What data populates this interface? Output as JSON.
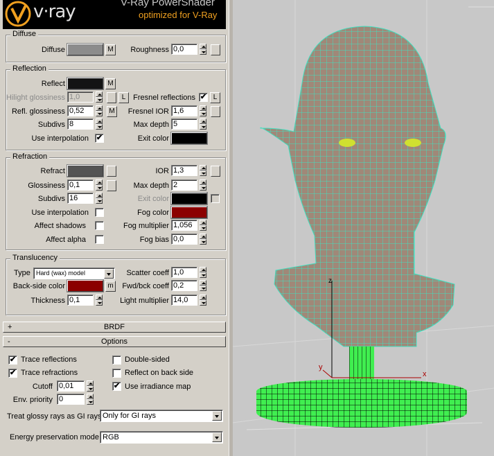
{
  "banner": {
    "logo": "v·ray",
    "title": "V-Ray PowerShader",
    "subtitle": "optimized for V-Ray"
  },
  "diffuse": {
    "group": "Diffuse",
    "diffuse_label": "Diffuse",
    "m": "M",
    "roughness_label": "Roughness",
    "roughness": "0,0",
    "color": "#8c8c8c"
  },
  "reflection": {
    "group": "Reflection",
    "reflect_label": "Reflect",
    "m": "M",
    "reflect_color": "#141414",
    "hilight_label": "Hilight glossiness",
    "hilight": "1,0",
    "l": "L",
    "fresnel_label": "Fresnel reflections",
    "fresnel_checked": "✔",
    "refl_gloss_label": "Refl. glossiness",
    "refl_gloss": "0,52",
    "fresnel_ior_label": "Fresnel IOR",
    "fresnel_ior": "1,6",
    "subdivs_label": "Subdivs",
    "subdivs": "8",
    "maxdepth_label": "Max depth",
    "maxdepth": "5",
    "interp_label": "Use interpolation",
    "interp_checked": "✔",
    "exit_label": "Exit color",
    "exit_color": "#000000"
  },
  "refraction": {
    "group": "Refraction",
    "refract_label": "Refract",
    "refract_color": "#545454",
    "ior_label": "IOR",
    "ior": "1,3",
    "gloss_label": "Glossiness",
    "gloss": "0,1",
    "maxdepth_label": "Max depth",
    "maxdepth": "2",
    "subdivs_label": "Subdivs",
    "subdivs": "16",
    "exit_label": "Exit color",
    "exit_color": "#000000",
    "interp_label": "Use interpolation",
    "fog_label": "Fog color",
    "fog_color": "#8b0000",
    "shadows_label": "Affect shadows",
    "fogmult_label": "Fog multiplier",
    "fogmult": "1,056",
    "alpha_label": "Affect alpha",
    "fogbias_label": "Fog bias",
    "fogbias": "0,0"
  },
  "translucency": {
    "group": "Translucency",
    "type_label": "Type",
    "type_value": "Hard (wax) model",
    "scatter_label": "Scatter coeff",
    "scatter": "1,0",
    "backside_label": "Back-side color",
    "backside_color": "#8b0000",
    "m": "m",
    "fwd_label": "Fwd/bck coeff",
    "fwd": "0,2",
    "thickness_label": "Thickness",
    "thickness": "0,1",
    "light_label": "Light multiplier",
    "light": "14,0"
  },
  "rollouts": {
    "brdf_sign": "+",
    "brdf": "BRDF",
    "options_sign": "-",
    "options": "Options"
  },
  "options": {
    "trace_refl": "Trace reflections",
    "trace_refr": "Trace refractions",
    "double_sided": "Double-sided",
    "reflect_back": "Reflect on back side",
    "irradiance": "Use irradiance map",
    "cutoff_label": "Cutoff",
    "cutoff": "0,01",
    "env_label": "Env. priority",
    "env": "0",
    "glossy_label": "Treat glossy rays as GI rays:",
    "glossy_value": "Only for GI rays",
    "energy_label": "Energy preservation mode:",
    "energy_value": "RGB",
    "check": "✔"
  },
  "viewport": {
    "axis_x": "x",
    "axis_y": "y",
    "axis_z": "z",
    "bg_color": "#c8c8c8",
    "wire_color": "#40e0c0",
    "base_color": "#40ee50"
  }
}
